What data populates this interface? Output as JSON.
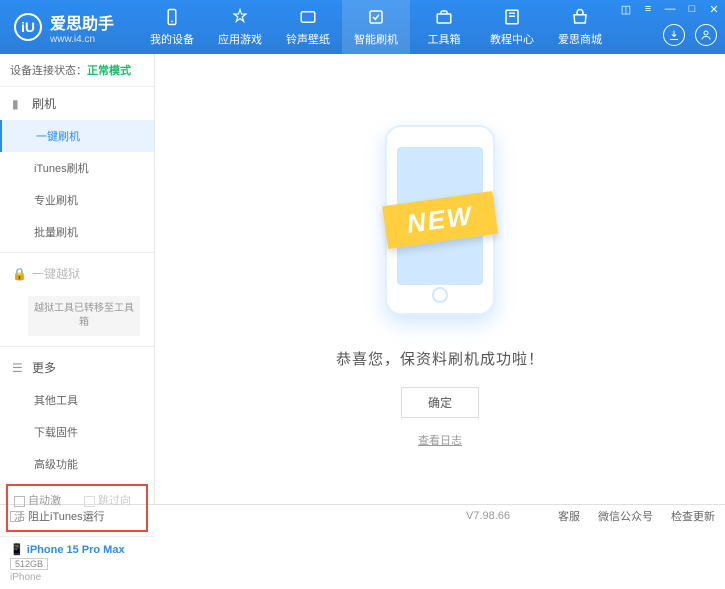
{
  "app": {
    "name": "爱思助手",
    "url": "www.i4.cn"
  },
  "nav": [
    {
      "label": "我的设备"
    },
    {
      "label": "应用游戏"
    },
    {
      "label": "铃声壁纸"
    },
    {
      "label": "智能刷机"
    },
    {
      "label": "工具箱"
    },
    {
      "label": "教程中心"
    },
    {
      "label": "爱思商城"
    }
  ],
  "status": {
    "label": "设备连接状态：",
    "mode": "正常模式"
  },
  "side": {
    "flash": "刷机",
    "items": [
      "一键刷机",
      "iTunes刷机",
      "专业刷机",
      "批量刷机"
    ],
    "jailbreak": "一键越狱",
    "jailnote": "越狱工具已转移至工具箱",
    "more": "更多",
    "moreitems": [
      "其他工具",
      "下载固件",
      "高级功能"
    ]
  },
  "checks": {
    "auto": "自动激活",
    "skip": "跳过向导"
  },
  "device": {
    "name": "iPhone 15 Pro Max",
    "storage": "512GB",
    "type": "iPhone"
  },
  "main": {
    "ribbon": "NEW",
    "msg": "恭喜您，保资料刷机成功啦！",
    "ok": "确定",
    "log": "查看日志"
  },
  "footer": {
    "block": "阻止iTunes运行",
    "ver": "V7.98.66",
    "links": [
      "客服",
      "微信公众号",
      "检查更新"
    ]
  }
}
